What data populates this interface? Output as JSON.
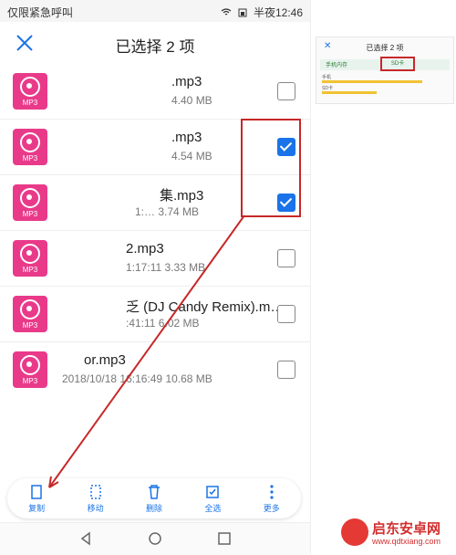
{
  "status_bar": {
    "carrier": "仅限紧急呼叫",
    "time": "半夜12:46"
  },
  "header": {
    "title": "已选择 2 项"
  },
  "files": [
    {
      "name": ".mp3",
      "meta": "4.40 MB",
      "checked": false,
      "icon_label": "MP3"
    },
    {
      "name": ".mp3",
      "meta": "4.54 MB",
      "checked": true,
      "icon_label": "MP3"
    },
    {
      "name": "集.mp3",
      "meta": "1:…  3.74 MB",
      "checked": true,
      "icon_label": "MP3"
    },
    {
      "name": "2.mp3",
      "meta": "1:17:11 3.33 MB",
      "checked": false,
      "icon_label": "MP3"
    },
    {
      "name": "乏 (DJ Candy Remix).m…",
      "meta": ":41:11 6.02 MB",
      "checked": false,
      "icon_label": "MP3"
    },
    {
      "name": "or.mp3",
      "meta": "2018/10/18 16:16:49 10.68 MB",
      "checked": false,
      "icon_label": "MP3"
    }
  ],
  "toolbar": {
    "copy": "复制",
    "move": "移动",
    "delete": "删除",
    "select_all": "全选",
    "more": "更多"
  },
  "thumbnail": {
    "title": "已选择 2 项",
    "tab1": "手机内存",
    "tab2": "SD卡",
    "bar1_label": "手机",
    "bar2_label": "SD卡"
  },
  "watermark": {
    "text": "启东安卓网",
    "url": "www.qdtxiang.com"
  },
  "colors": {
    "accent": "#1a73e8",
    "annotation": "#c62828",
    "thumb": "#e93a8a"
  }
}
